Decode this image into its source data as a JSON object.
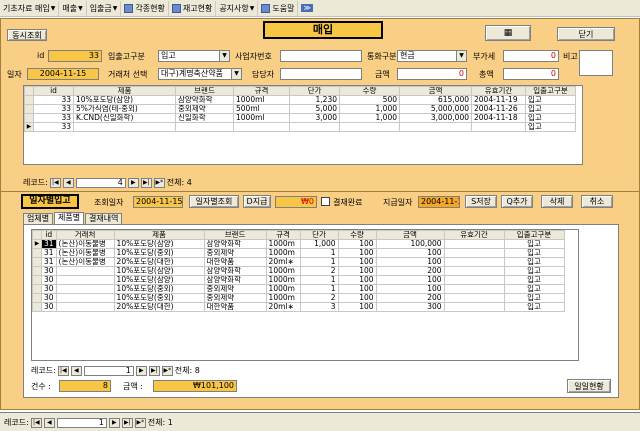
{
  "menubar": [
    "기초자료 매입",
    "매출",
    "입출금",
    "각종현황",
    "재고현황",
    "공지사항",
    "도움말"
  ],
  "header": {
    "title": "매입",
    "sync_btn": "동시조회",
    "close_btn": "닫기",
    "calc_btn": "계산기"
  },
  "master": {
    "id_label": "id",
    "id_value": "33",
    "inout_label": "입출고구분",
    "inout_value": "입고",
    "bizno_label": "사업자번호",
    "bizno_value": "",
    "currency_label": "통화구분",
    "currency_value": "현금",
    "vat_label": "부가세",
    "vat_value": "0",
    "memo_label": "비고",
    "date_label": "일자",
    "date_value": "2004-11-15",
    "vendor_label": "거래처 선택",
    "vendor_value": "대구)계명축산약품",
    "manager_label": "담당자",
    "manager_value": "",
    "amount_label": "금액",
    "amount_value": "0",
    "total_label": "총액",
    "total_value": "0"
  },
  "top_grid": {
    "headers": [
      "id",
      "제품",
      "브랜드",
      "규격",
      "단가",
      "수량",
      "금액",
      "유효기간",
      "입출고구분"
    ],
    "rows": [
      [
        "33",
        "10%포도당(삼양)",
        "삼양약화학",
        "1000ml",
        "1,230",
        "500",
        "615,000",
        "2004-11-19",
        "입고"
      ],
      [
        "33",
        "5%가식염(테-중외)",
        "중외제약",
        "500ml",
        "5,000",
        "1,000",
        "5,000,000",
        "2004-11-26",
        "입고"
      ],
      [
        "33",
        "K.CND(신일화학)",
        "신일화학",
        "1000ml",
        "3,000",
        "1,000",
        "3,000,000",
        "2004-11-18",
        "입고"
      ],
      [
        "33",
        "",
        "",
        "",
        "",
        "",
        "",
        "",
        "입고"
      ]
    ],
    "nav_label": "레코드:",
    "nav_pos": "4",
    "nav_total": "전체: 4"
  },
  "daily": {
    "title": "일자별입고",
    "query_date_label": "조회일자",
    "query_date_value": "2004-11-15",
    "daily_btn": "일자별조회",
    "dpay_btn": "D지급",
    "dpay_value": "₩0",
    "settle_label": "결재완료",
    "pay_date_label": "지급일자",
    "pay_date_value": "2004-11-15",
    "save_btn": "S저장",
    "add_btn": "Q추가",
    "delete_btn": "삭제",
    "cancel_btn": "취소",
    "tabs": [
      "업체별",
      "제품별",
      "결재내역"
    ]
  },
  "bottom_grid": {
    "headers": [
      "id",
      "거래처",
      "제품",
      "브랜드",
      "규격",
      "단가",
      "수량",
      "금액",
      "유효기간",
      "입출고구분"
    ],
    "rows": [
      [
        "31",
        "(논산)이동물병",
        "10%포도당(삼양)",
        "삼양약화학",
        "1000m",
        "1,000",
        "100",
        "100,000",
        "",
        "입고"
      ],
      [
        "31",
        "(논산)이동물병",
        "10%포도당(중외)",
        "중외제약",
        "1000m",
        "1",
        "100",
        "100",
        "",
        "입고"
      ],
      [
        "31",
        "(논산)이동물병",
        "20%포도당(대한)",
        "대한약품",
        "20ml∗",
        "1",
        "100",
        "100",
        "",
        "입고"
      ],
      [
        "30",
        "",
        "10%포도당(삼양)",
        "삼양약화학",
        "1000m",
        "2",
        "100",
        "200",
        "",
        "입고"
      ],
      [
        "30",
        "",
        "10%포도당(삼양)",
        "삼양약화학",
        "1000m",
        "1",
        "100",
        "100",
        "",
        "입고"
      ],
      [
        "30",
        "",
        "10%포도당(중외)",
        "중외제약",
        "1000m",
        "1",
        "100",
        "100",
        "",
        "입고"
      ],
      [
        "30",
        "",
        "10%포도당(중외)",
        "중외제약",
        "1000m",
        "2",
        "100",
        "200",
        "",
        "입고"
      ],
      [
        "30",
        "",
        "20%포도당(대한)",
        "대한약품",
        "20ml∗",
        "3",
        "100",
        "300",
        "",
        "입고"
      ]
    ],
    "nav_label": "레코드:",
    "nav_pos": "1",
    "nav_total": "전체: 8",
    "count_label": "건수 :",
    "count_value": "8",
    "amount_label": "금액 :",
    "amount_value": "₩101,100",
    "status_btn": "일일현황"
  },
  "statusbar": {
    "nav_label": "레코드:",
    "nav_pos": "1",
    "nav_total": "전체: 1"
  }
}
